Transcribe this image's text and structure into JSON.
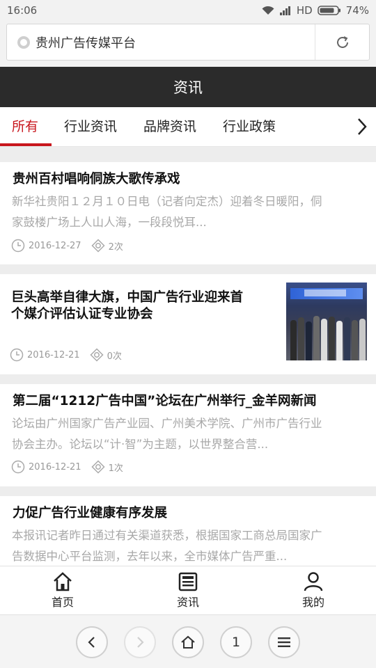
{
  "status_bar": {
    "time": "16:06",
    "network": "HD",
    "battery": "74%"
  },
  "browser": {
    "url_text": "贵州广告传媒平台",
    "tab_count": "1"
  },
  "header": {
    "title": "资讯"
  },
  "tabs": [
    {
      "label": "所有",
      "active": true
    },
    {
      "label": "行业资讯",
      "active": false
    },
    {
      "label": "品牌资讯",
      "active": false
    },
    {
      "label": "行业政策",
      "active": false
    }
  ],
  "articles": [
    {
      "title": "贵州百村唱响侗族大歌传承戏",
      "summary_line1": "新华社贵阳１２月１０日电（记者向定杰）迎着冬日暖阳，侗",
      "summary_line2": "家鼓楼广场上人山人海，一段段悦耳...",
      "date": "2016-12-27",
      "views": "2次"
    },
    {
      "title_line1": "巨头高举自律大旗，中国广告行业迎来首",
      "title_line2": "个媒介评估认证专业协会",
      "date": "2016-12-21",
      "views": "0次",
      "has_thumbnail": true
    },
    {
      "title": "第二届“1212广告中国”论坛在广州举行_金羊网新闻",
      "summary_line1": "论坛由广州国家广告产业园、广州美术学院、广州市广告行业",
      "summary_line2": "协会主办。论坛以“计·智”为主题，以世界整合营...",
      "date": "2016-12-21",
      "views": "1次"
    },
    {
      "title": "力促广告行业健康有序发展",
      "summary_line1": "本报讯记者昨日通过有关渠道获悉，根据国家工商总局国家广",
      "summary_line2": "告数据中心平台监测，去年以来，全市媒体广告严重..."
    }
  ],
  "bottom_nav": [
    {
      "label": "首页",
      "icon": "home-icon"
    },
    {
      "label": "资讯",
      "icon": "news-icon"
    },
    {
      "label": "我的",
      "icon": "user-icon"
    }
  ],
  "colors": {
    "accent": "#c8161d",
    "header_bg": "#2b2b2b",
    "summary_text": "#a8a8a8"
  }
}
